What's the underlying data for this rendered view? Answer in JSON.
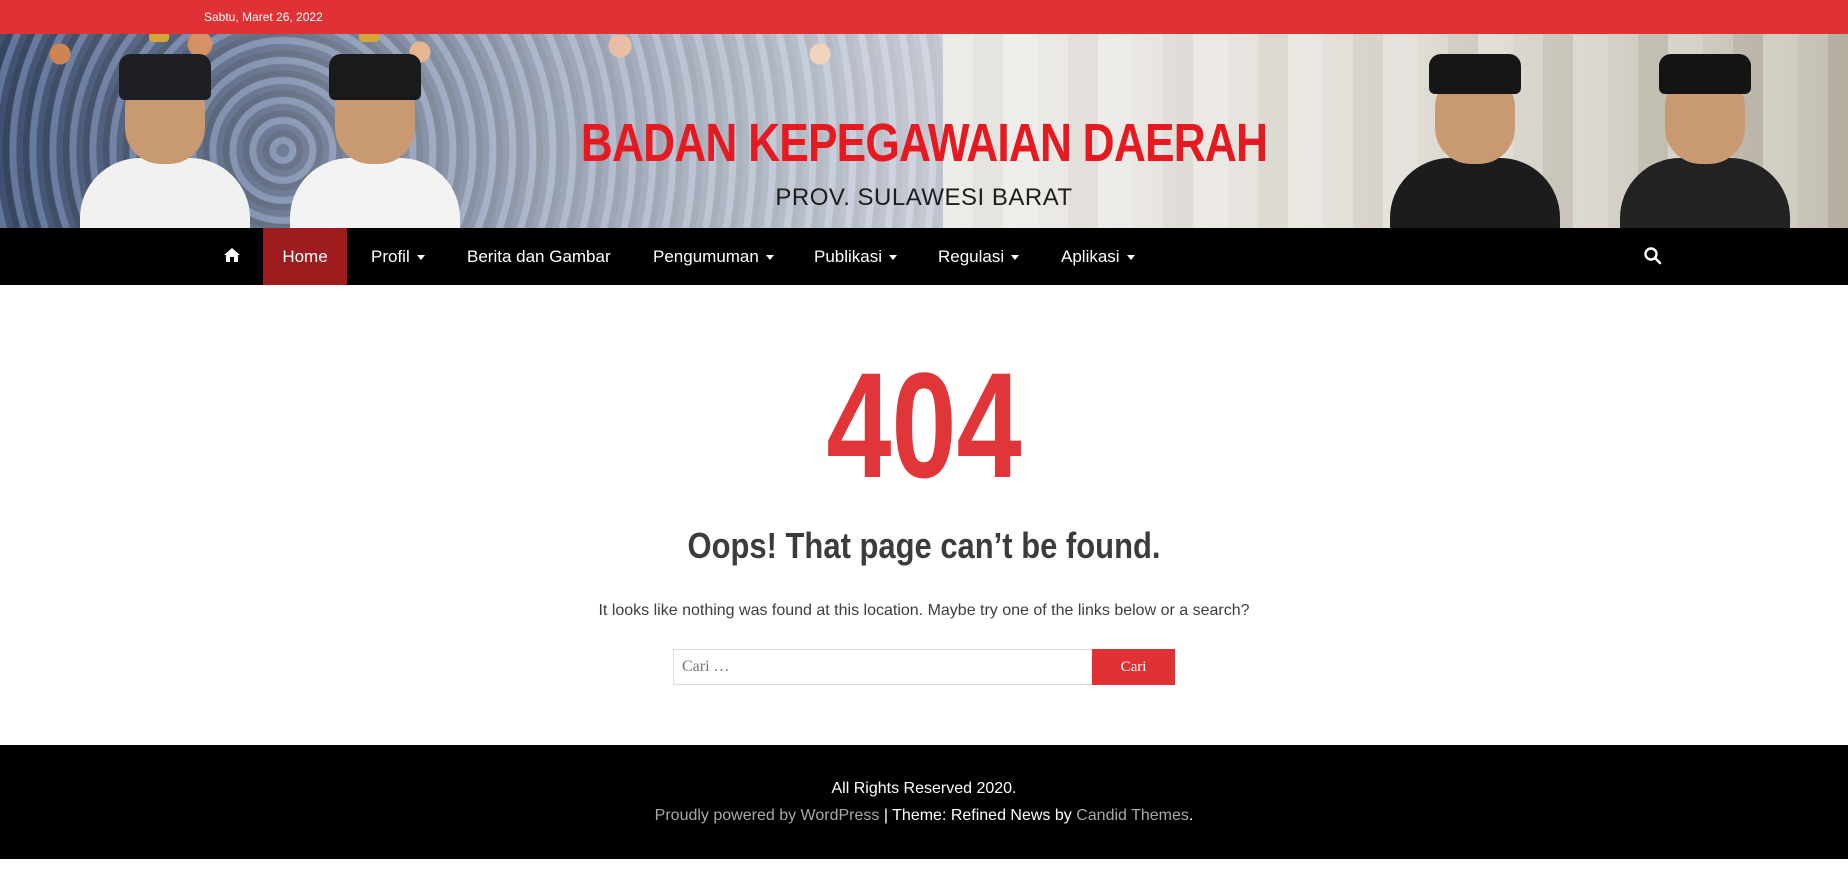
{
  "topbar": {
    "date": "Sabtu, Maret 26, 2022",
    "bg_color": "#e03134"
  },
  "header": {
    "title": "BADAN KEPEGAWAIAN DAERAH",
    "subtitle": "PROV. SULAWESI BARAT",
    "title_color": "#e5191f"
  },
  "nav": {
    "items": [
      {
        "label": "Home",
        "active": true,
        "has_dropdown": false
      },
      {
        "label": "Profil",
        "has_dropdown": true
      },
      {
        "label": "Berita dan Gambar",
        "has_dropdown": false
      },
      {
        "label": "Pengumuman",
        "has_dropdown": true
      },
      {
        "label": "Publikasi",
        "has_dropdown": true
      },
      {
        "label": "Regulasi",
        "has_dropdown": true
      },
      {
        "label": "Aplikasi",
        "has_dropdown": true
      }
    ],
    "home_icon": "home-icon",
    "search_icon": "search-icon",
    "active_color": "#9f1c1e"
  },
  "main": {
    "error_code": "404",
    "heading": "Oops! That page can’t be found.",
    "message": "It looks like nothing was found at this location. Maybe try one of the links below or a search?",
    "search": {
      "placeholder": "Cari …",
      "button_label": "Cari"
    },
    "accent_color": "#e0363a"
  },
  "footer": {
    "copyright": "All Rights Reserved 2020.",
    "powered_by": "Proudly powered by WordPress",
    "separator": " | ",
    "theme_prefix": "Theme: Refined News by ",
    "theme_author": "Candid Themes",
    "end": "."
  }
}
